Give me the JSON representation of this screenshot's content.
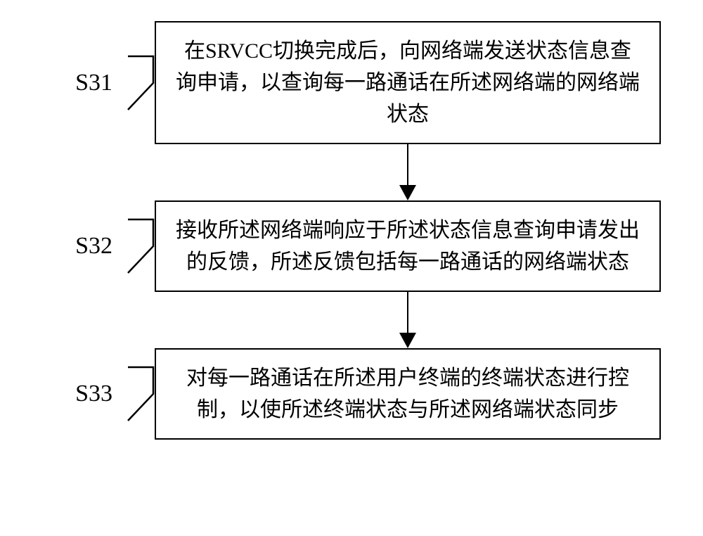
{
  "chart_data": {
    "type": "flowchart",
    "direction": "vertical",
    "nodes": [
      {
        "id": "S31",
        "label": "S31",
        "text": "在SRVCC切换完成后，向网络端发送状态信息查询申请，以查询每一路通话在所述网络端的网络端状态"
      },
      {
        "id": "S32",
        "label": "S32",
        "text": "接收所述网络端响应于所述状态信息查询申请发出的反馈，所述反馈包括每一路通话的网络端状态"
      },
      {
        "id": "S33",
        "label": "S33",
        "text": "对每一路通话在所述用户终端的终端状态进行控制，以使所述终端状态与所述网络端状态同步"
      }
    ],
    "edges": [
      {
        "from": "S31",
        "to": "S32"
      },
      {
        "from": "S32",
        "to": "S33"
      }
    ]
  }
}
